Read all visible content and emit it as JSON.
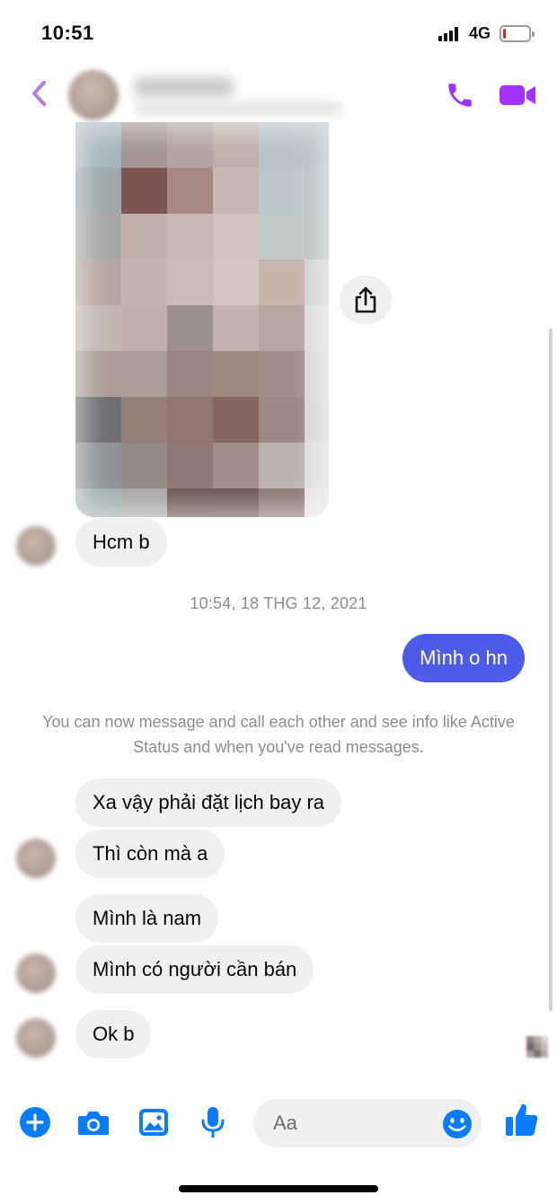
{
  "status_bar": {
    "time": "10:51",
    "network": "4G",
    "battery_level": 0.1
  },
  "colors": {
    "accent": "#a033ff",
    "outgoing_bubble": "#4d5be9",
    "composer_icons": "#0a7cff",
    "incoming_bubble": "#f0f0f0",
    "battery_low": "#e02424"
  },
  "icons": {
    "back": "chevron-left-icon",
    "call": "phone-icon",
    "video": "video-camera-icon",
    "share": "share-icon",
    "more": "plus-icon",
    "camera": "camera-icon",
    "gallery": "image-icon",
    "voice": "microphone-icon",
    "emoji": "emoji-icon",
    "like": "thumbs-up-icon"
  },
  "messages": {
    "m1": "Hcm b",
    "timestamp": "10:54, 18 THG 12, 2021",
    "m2": "Mình o hn",
    "notice": "You can now message and call each other and see info like Active Status and when you've read messages.",
    "m3": "Xa vậy phải đặt lịch bay ra",
    "m4": "Thì còn mà a",
    "m5": "Mình là nam",
    "m6": "Mình có người cần bán",
    "m7": "Ok b"
  },
  "composer": {
    "placeholder": "Aa"
  }
}
